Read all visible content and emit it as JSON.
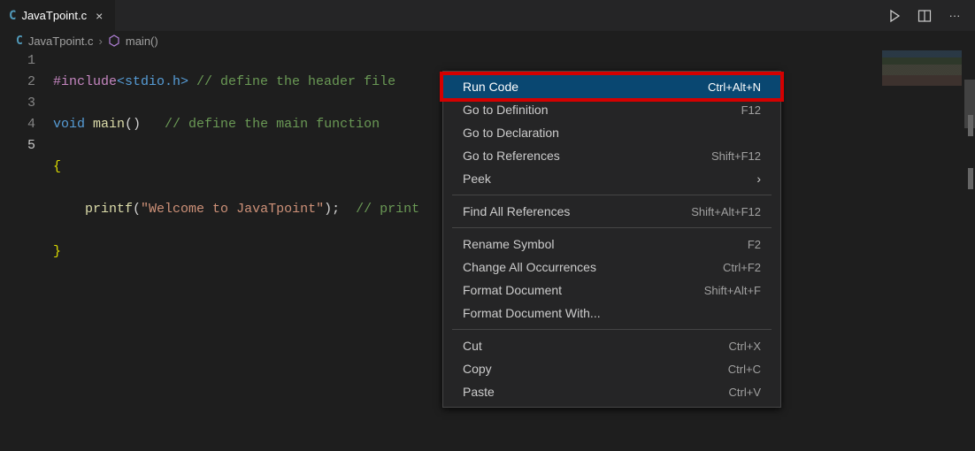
{
  "tab": {
    "file_icon_letter": "C",
    "filename": "JavaTpoint.c",
    "close_glyph": "×"
  },
  "breadcrumb": {
    "file_icon_letter": "C",
    "filename": "JavaTpoint.c",
    "chevron": "›",
    "symbol": "main()"
  },
  "code": {
    "lines": [
      {
        "num": "1",
        "pre": "#include",
        "inc": "<stdio.h>",
        "cmt": " // define the header file"
      },
      {
        "num": "2",
        "kw1": "void ",
        "fn": "main",
        "pn": "()   ",
        "cmt": "// define the main function"
      },
      {
        "num": "3",
        "brace": "{"
      },
      {
        "num": "4",
        "indent": "    ",
        "fn": "printf",
        "pn1": "(",
        "str": "\"Welcome to JavaTpoint\"",
        "pn2": ");  ",
        "cmt": "// print"
      },
      {
        "num": "5",
        "brace": "}"
      }
    ]
  },
  "menu": {
    "items": [
      {
        "label": "Run Code",
        "shortcut": "Ctrl+Alt+N",
        "highlighted": true
      },
      {
        "label": "Go to Definition",
        "shortcut": "F12"
      },
      {
        "label": "Go to Declaration",
        "shortcut": ""
      },
      {
        "label": "Go to References",
        "shortcut": "Shift+F12"
      },
      {
        "label": "Peek",
        "shortcut": "",
        "submenu": true
      },
      {
        "sep": true
      },
      {
        "label": "Find All References",
        "shortcut": "Shift+Alt+F12"
      },
      {
        "sep": true
      },
      {
        "label": "Rename Symbol",
        "shortcut": "F2"
      },
      {
        "label": "Change All Occurrences",
        "shortcut": "Ctrl+F2"
      },
      {
        "label": "Format Document",
        "shortcut": "Shift+Alt+F"
      },
      {
        "label": "Format Document With...",
        "shortcut": ""
      },
      {
        "sep": true
      },
      {
        "label": "Cut",
        "shortcut": "Ctrl+X"
      },
      {
        "label": "Copy",
        "shortcut": "Ctrl+C"
      },
      {
        "label": "Paste",
        "shortcut": "Ctrl+V"
      }
    ]
  },
  "titlebar_icons": {
    "run": "▷",
    "split": "◫",
    "more": "···"
  }
}
